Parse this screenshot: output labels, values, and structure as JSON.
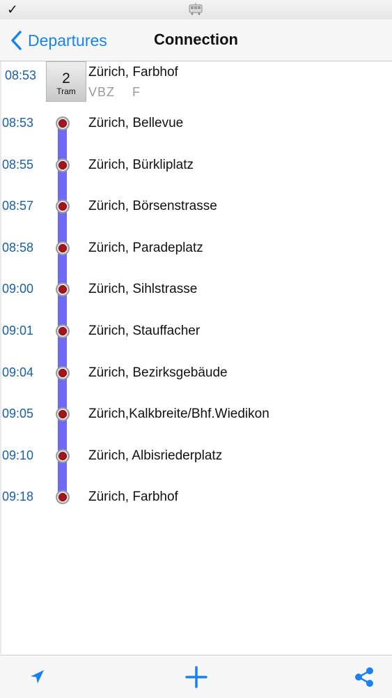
{
  "status_bar": {
    "check_glyph": "✓",
    "center_icon": "tram-icon"
  },
  "nav": {
    "back_label": "Departures",
    "title": "Connection"
  },
  "header": {
    "time": "08:53",
    "line_number": "2",
    "line_type": "Tram",
    "station": "Zürich, Farbhof",
    "operator": "VBZ",
    "platform": "F"
  },
  "stops": [
    {
      "time": "08:53",
      "name": "Zürich, Bellevue"
    },
    {
      "time": "08:55",
      "name": "Zürich, Bürkliplatz"
    },
    {
      "time": "08:57",
      "name": "Zürich, Börsenstrasse"
    },
    {
      "time": "08:58",
      "name": "Zürich, Paradeplatz"
    },
    {
      "time": "09:00",
      "name": "Zürich, Sihlstrasse"
    },
    {
      "time": "09:01",
      "name": "Zürich, Stauffacher"
    },
    {
      "time": "09:04",
      "name": "Zürich, Bezirksgebäude"
    },
    {
      "time": "09:05",
      "name": "Zürich,Kalkbreite/Bhf.Wiedikon"
    },
    {
      "time": "09:10",
      "name": "Zürich, Albisriederplatz"
    },
    {
      "time": "09:18",
      "name": "Zürich, Farbhof"
    }
  ],
  "toolbar": {
    "left_icon": "location-arrow-icon",
    "center_icon": "plus-icon",
    "right_icon": "share-icon"
  },
  "colors": {
    "accent": "#1a82f0",
    "route_line": "#6f6af5",
    "stop_dot": "#a3141d",
    "time_text": "#1d5fa0"
  }
}
